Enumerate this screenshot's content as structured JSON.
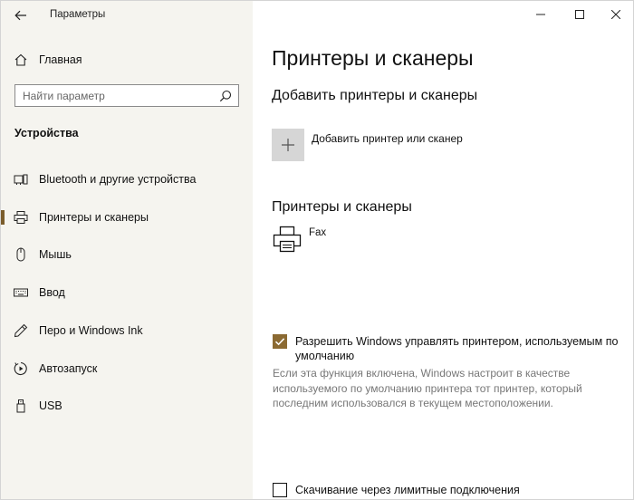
{
  "window": {
    "title": "Параметры"
  },
  "sidebar": {
    "home_label": "Главная",
    "search_placeholder": "Найти параметр",
    "section_title": "Устройства",
    "items": [
      {
        "label": "Bluetooth и другие устройства",
        "icon": "bluetooth-devices-icon",
        "active": false
      },
      {
        "label": "Принтеры и сканеры",
        "icon": "printer-icon",
        "active": true
      },
      {
        "label": "Мышь",
        "icon": "mouse-icon",
        "active": false
      },
      {
        "label": "Ввод",
        "icon": "keyboard-icon",
        "active": false
      },
      {
        "label": "Перо и Windows Ink",
        "icon": "pen-icon",
        "active": false
      },
      {
        "label": "Автозапуск",
        "icon": "autoplay-icon",
        "active": false
      },
      {
        "label": "USB",
        "icon": "usb-icon",
        "active": false
      }
    ]
  },
  "main": {
    "page_title": "Принтеры и сканеры",
    "add_section_title": "Добавить принтеры и сканеры",
    "add_button_label": "Добавить принтер или сканер",
    "list_section_title": "Принтеры и сканеры",
    "printers": [
      {
        "name": "Fax"
      }
    ],
    "default_printer_checkbox": {
      "checked": true,
      "line1": "Разрешить Windows управлять принтером, используемым по",
      "line2": "умолчанию"
    },
    "default_printer_description": "Если эта функция включена, Windows настроит в качестве используемого по умолчанию принтера тот принтер, который последним использовался в текущем местоположении.",
    "metered_checkbox": {
      "checked": false,
      "label": "Скачивание через лимитные подключения"
    }
  },
  "colors": {
    "accent": "#8b6a32",
    "sidebar_bg": "#f5f4ef",
    "add_tile_bg": "#d6d6d6",
    "description_text": "#777777"
  }
}
